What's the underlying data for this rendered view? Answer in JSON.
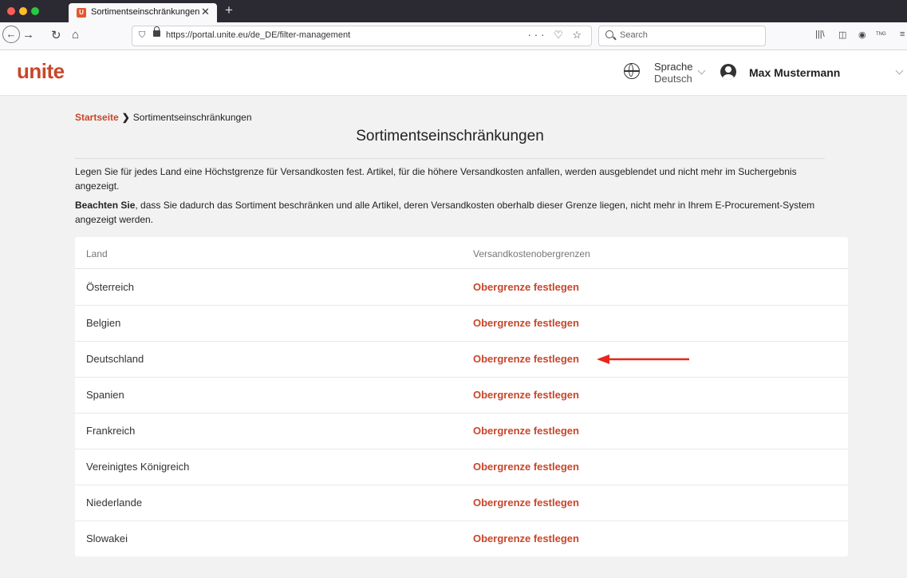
{
  "browser": {
    "tab_title": "Sortimentseinschränkungen",
    "tab_favicon_letter": "U",
    "tab_close": "✕",
    "new_tab": "+",
    "url": "https://portal.unite.eu/de_DE/filter-management",
    "url_actions": "··· ♡ ☆",
    "search_placeholder": "Search",
    "toolbar_extra": "TNG"
  },
  "header": {
    "logo": "unite",
    "language_label": "Sprache",
    "language_value": "Deutsch",
    "user_name": "Max Mustermann"
  },
  "breadcrumb": {
    "home": "Startseite",
    "separator": "❯",
    "current": "Sortimentseinschränkungen"
  },
  "page": {
    "title": "Sortimentseinschränkungen",
    "desc1": "Legen Sie für jedes Land eine Höchstgrenze für Versandkosten fest. Artikel, für die höhere Versandkosten anfallen, werden ausgeblendet und nicht mehr im Suchergebnis angezeigt.",
    "desc2_bold": "Beachten Sie",
    "desc2_rest": ", dass Sie dadurch das Sortiment beschränken und alle Artikel, deren Versandkosten oberhalb dieser Grenze liegen, nicht mehr in Ihrem E-Procurement-System angezeigt werden."
  },
  "table": {
    "headers": [
      "Land",
      "Versandkostenobergrenzen"
    ],
    "action_label": "Obergrenze festlegen",
    "rows": [
      {
        "country": "Österreich"
      },
      {
        "country": "Belgien"
      },
      {
        "country": "Deutschland"
      },
      {
        "country": "Spanien"
      },
      {
        "country": "Frankreich"
      },
      {
        "country": "Vereinigtes Königreich"
      },
      {
        "country": "Niederlande"
      },
      {
        "country": "Slowakei"
      }
    ]
  },
  "colors": {
    "brand": "#c8462a",
    "annotation_arrow": "#e8261b"
  }
}
